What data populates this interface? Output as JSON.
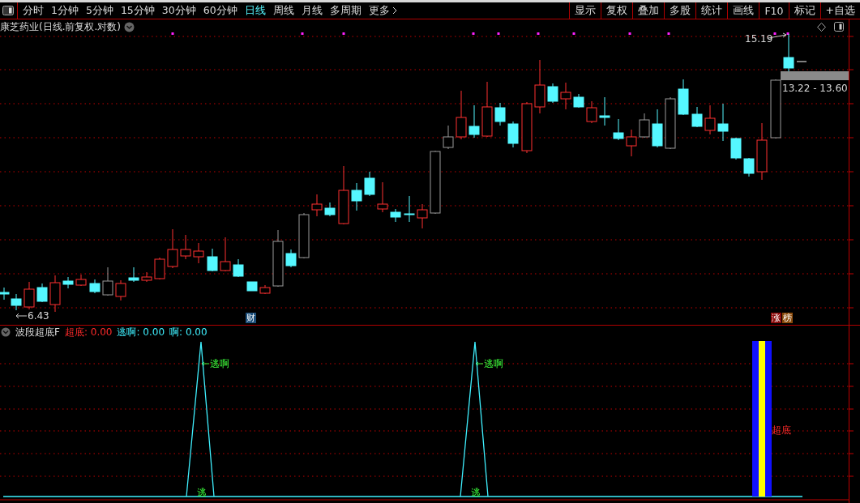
{
  "period_tabs": [
    {
      "label": "分时",
      "selected": false
    },
    {
      "label": "1分钟",
      "selected": false
    },
    {
      "label": "5分钟",
      "selected": false
    },
    {
      "label": "15分钟",
      "selected": false
    },
    {
      "label": "30分钟",
      "selected": false
    },
    {
      "label": "60分钟",
      "selected": false
    },
    {
      "label": "日线",
      "selected": true
    },
    {
      "label": "周线",
      "selected": false
    },
    {
      "label": "月线",
      "selected": false
    },
    {
      "label": "多周期",
      "selected": false
    },
    {
      "label": "更多",
      "selected": false
    }
  ],
  "tools": [
    "显示",
    "复权",
    "叠加",
    "多股",
    "统计",
    "画线",
    "F10",
    "标记",
    "+自选"
  ],
  "chart": {
    "title": "康芝药业(日线.前复权.对数)",
    "high_label": "15.19",
    "low_label": "6.43",
    "price_range": "13.22 - 13.60",
    "markers": [
      {
        "label": "财",
        "color": "#1d4f7a"
      },
      {
        "label": "涨",
        "color": "#8a0a0a"
      },
      {
        "label": "榜",
        "color": "#8a4a0a"
      }
    ]
  },
  "indicator": {
    "name": "波段超底F",
    "values": [
      {
        "label": "超底:",
        "value": "0.00",
        "color": "#ff2a2a"
      },
      {
        "label": "逃啊:",
        "value": "0.00",
        "color": "#3ff0ff"
      },
      {
        "label": "啊:",
        "value": "0.00",
        "color": "#3ff0ff"
      }
    ],
    "signals": [
      {
        "kind": "peak",
        "top_label": "逃啊",
        "bottom_label": "逃"
      },
      {
        "kind": "peak",
        "top_label": "逃啊",
        "bottom_label": "逃"
      },
      {
        "kind": "bar",
        "label": "超底"
      }
    ]
  }
}
